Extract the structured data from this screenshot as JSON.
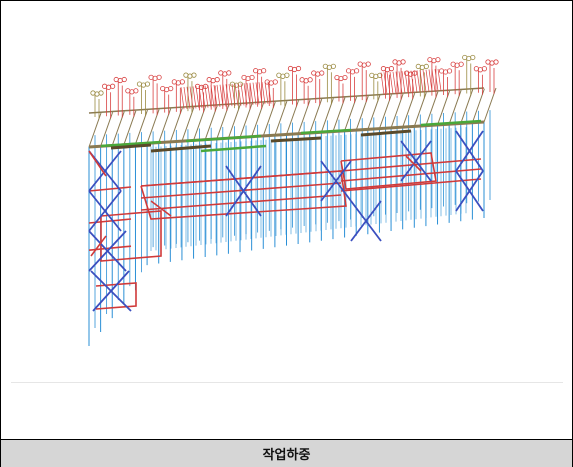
{
  "figure": {
    "caption": "작업하중"
  },
  "diagram": {
    "subject": "scaffold-structure-3d-wireframe",
    "colors": {
      "verticals": "#2a8fd6",
      "bracing": "#d03a3a",
      "bracing_blue": "#3b4fbf",
      "deck": "#8a7a52",
      "load_arrows": "#d84040",
      "load_arrows_alt": "#9a8a40",
      "deck_green": "#4aa83a"
    }
  }
}
